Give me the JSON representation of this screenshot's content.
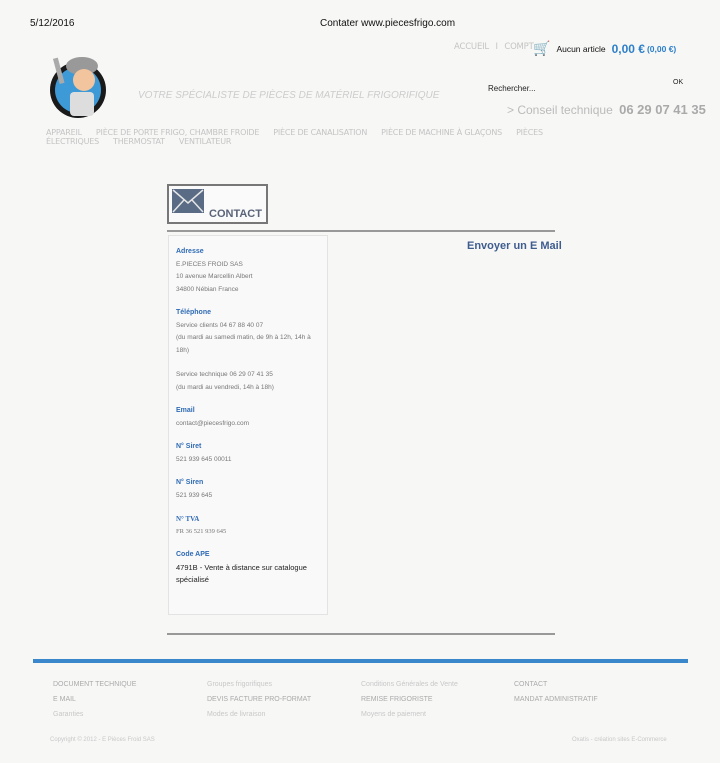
{
  "print_header": {
    "date": "5/12/2016",
    "title": "Contater www.piecesfrigo.com"
  },
  "header": {
    "accueil": "ACCUEIL",
    "separator": "I",
    "compte": "COMPT",
    "cart_label": "Aucun article",
    "cart_total": "0,00 €",
    "cart_total_paren": "(0,00 €)",
    "search_placeholder": "Rechercher...",
    "search_ok": "OK",
    "tagline": "VOTRE SPÉCIALISTE DE PIÈCES DE MATÉRIEL FRIGORIFIQUE",
    "conseil_label": "> Conseil technique",
    "conseil_phone": "06 29 07 41 35"
  },
  "nav": [
    "APPAREIL",
    "PIÈCE DE PORTE FRIGO, CHAMBRE FROIDE",
    "PIÈCE DE CANALISATION",
    "PIÈCE DE MACHINE À GLAÇONS",
    "PIÈCES ÉLECTRIQUES",
    "THERMOSTAT",
    "VENTILATEUR"
  ],
  "page": {
    "title": "CONTACT",
    "send_email": "Envoyer un E Mail"
  },
  "contact": {
    "adresse": {
      "label": "Adresse",
      "lines": [
        "E.PIECES FROID SAS",
        "10 avenue Marcellin Albert",
        "34800 Nébian France"
      ]
    },
    "telephone": {
      "label": "Téléphone",
      "lines": [
        "Service clients 04 67 88 40 07",
        "(du mardi au samedi matin, de 9h à 12h, 14h à 18h)",
        "Service technique 06 29 07 41 35",
        "(du mardi au vendredi, 14h à 18h)"
      ]
    },
    "email": {
      "label": "Email",
      "value": "contact@piecesfrigo.com"
    },
    "siret": {
      "label": "N° Siret",
      "value": "521 939 645 00011"
    },
    "siren": {
      "label": "N° Siren",
      "value": "521 939 645"
    },
    "tva": {
      "label": "N° TVA",
      "value": "FR 36 521 939 645"
    },
    "ape": {
      "label": "Code APE",
      "value": "4791B - Vente à distance sur catalogue spécialisé"
    }
  },
  "footer": {
    "cols": [
      [
        "DOCUMENT TECHNIQUE",
        "E MAIL",
        "Garanties"
      ],
      [
        "Groupes frigorifiques",
        "DEVIS FACTURE PRO-FORMAT",
        "Modes de livraison"
      ],
      [
        "Conditions Générales de Vente",
        "REMISE FRIGORISTE",
        "Moyens de paiement"
      ],
      [
        "CONTACT",
        "MANDAT ADMINISTRATIF"
      ]
    ],
    "copyright": "Copyright © 2012 - E Pièces Froid SAS",
    "credit": "Oxatis - création sites E-Commerce"
  },
  "colors": {
    "accent": "#2d7fc9",
    "footer_bar": "#3a87cc"
  }
}
